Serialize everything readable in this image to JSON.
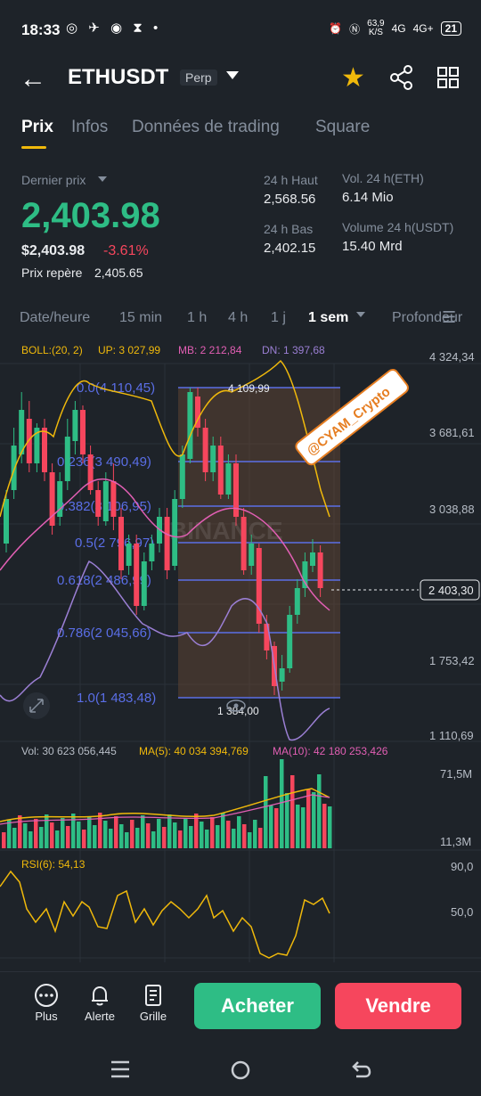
{
  "status": {
    "time": "18:33",
    "net_speed": "63,9",
    "net_unit": "K/S",
    "signal1": "4G",
    "signal2": "4G+",
    "battery": "21"
  },
  "header": {
    "symbol": "ETHUSDT",
    "contract": "Perp",
    "colors": {
      "star": "#f0b90b"
    }
  },
  "tabs": [
    "Prix",
    "Infos",
    "Données de trading",
    "Square"
  ],
  "price": {
    "last_label": "Dernier prix",
    "last": "2,403.98",
    "usd": "$2,403.98",
    "change": "-3.61%",
    "mark_label": "Prix repère",
    "mark": "2,405.65",
    "high_label": "24 h Haut",
    "high": "2,568.56",
    "low_label": "24 h Bas",
    "low": "2,402.15",
    "vol_eth_label": "Vol. 24 h(ETH)",
    "vol_eth": "6.14 Mio",
    "vol_usdt_label": "Volume 24 h(USDT)",
    "vol_usdt": "15.40 Mrd",
    "colors": {
      "up": "#2ebd85",
      "down": "#f6465d"
    }
  },
  "intervals": {
    "items": [
      "Date/heure",
      "15 min",
      "1 h",
      "4 h",
      "1 j",
      "1 sem",
      "Profondeur"
    ],
    "active": "1 sem"
  },
  "chart": {
    "boll": {
      "label": "BOLL:(20, 2)",
      "up": "UP: 3 027,99",
      "mb": "MB: 2 212,84",
      "dn": "DN: 1 397,68"
    },
    "y_ticks": [
      "4 324,34",
      "3 681,61",
      "3 038,88",
      "2 403,30",
      "1 753,42",
      "1 110,69"
    ],
    "current": "2 403,30",
    "fib": [
      "0.0(4 110,45)",
      "0.236(3 490,49)",
      "0.382(3 106,95)",
      "0.5(2 796,97)",
      "0.618(2 486,99)",
      "0.786(2 045,66)",
      "1.0(1 483,48)"
    ],
    "high_mark": "4 109,99",
    "low_mark": "1 384,00",
    "watermark": "BINANCE",
    "sticker": "@CYAM_Crypto",
    "volume": {
      "label": "Vol: 30 623 056,445",
      "ma5": "MA(5): 40 034 394,769",
      "ma10": "MA(10): 42 180 253,426",
      "max": "71,5M",
      "min": "11,3M"
    },
    "rsi": {
      "label": "RSI(6): 54,13",
      "t1": "90,0",
      "t2": "50,0"
    },
    "colors": {
      "up": "#2ebd85",
      "down": "#f6465d",
      "boll_up": "#f0b90b",
      "boll_mb": "#e25fb4",
      "boll_dn": "#9b7fd4",
      "fib": "#5a6ee6"
    }
  },
  "bottom": {
    "plus": "Plus",
    "alert": "Alerte",
    "grid": "Grille",
    "buy": "Acheter",
    "sell": "Vendre"
  }
}
